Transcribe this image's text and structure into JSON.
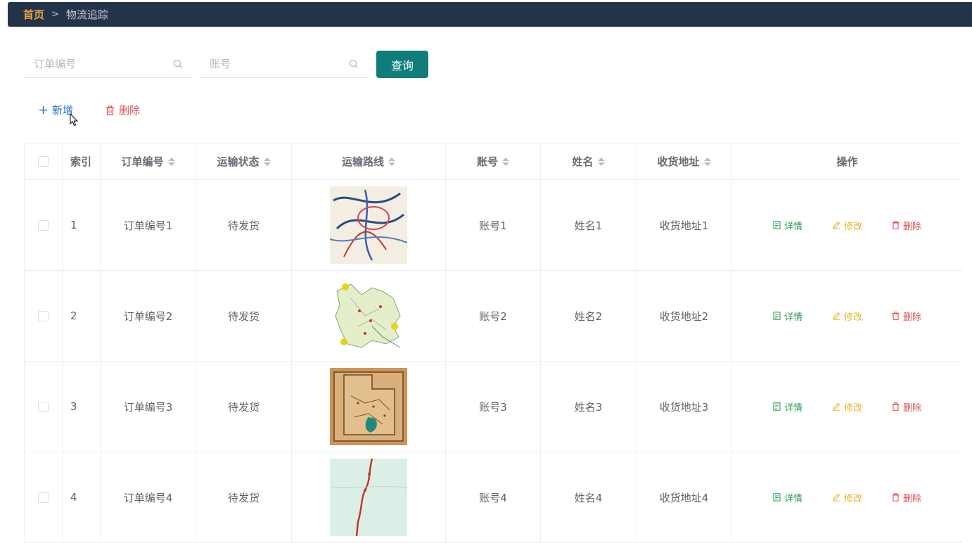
{
  "breadcrumb": {
    "home": "首页",
    "separator": ">",
    "current": "物流追踪"
  },
  "search": {
    "order_placeholder": "订单编号",
    "account_placeholder": "账号",
    "query_label": "查询"
  },
  "actions": {
    "add_label": "新增",
    "delete_label": "删除"
  },
  "table": {
    "headers": [
      "索引",
      "订单编号",
      "运输状态",
      "运输路线",
      "账号",
      "姓名",
      "收货地址",
      "操作"
    ],
    "op_labels": {
      "detail": "详情",
      "edit": "修改",
      "delete": "删除"
    },
    "rows": [
      {
        "index": "1",
        "order": "订单编号1",
        "status": "待发货",
        "route_image": "route-map-1",
        "account": "账号1",
        "name": "姓名1",
        "address": "收货地址1"
      },
      {
        "index": "2",
        "order": "订单编号2",
        "status": "待发货",
        "route_image": "route-map-2",
        "account": "账号2",
        "name": "姓名2",
        "address": "收货地址2"
      },
      {
        "index": "3",
        "order": "订单编号3",
        "status": "待发货",
        "route_image": "route-map-3",
        "account": "账号3",
        "name": "姓名3",
        "address": "收货地址3"
      },
      {
        "index": "4",
        "order": "订单编号4",
        "status": "待发货",
        "route_image": "route-map-4",
        "account": "账号4",
        "name": "姓名4",
        "address": "收货地址4"
      }
    ]
  },
  "colors": {
    "topbar": "#243448",
    "home": "#e6a23c",
    "query_button": "#0f7d7a",
    "add": "#1a73c9",
    "delete": "#d9534f",
    "detail": "#2f9b4e",
    "edit": "#e6b323"
  }
}
